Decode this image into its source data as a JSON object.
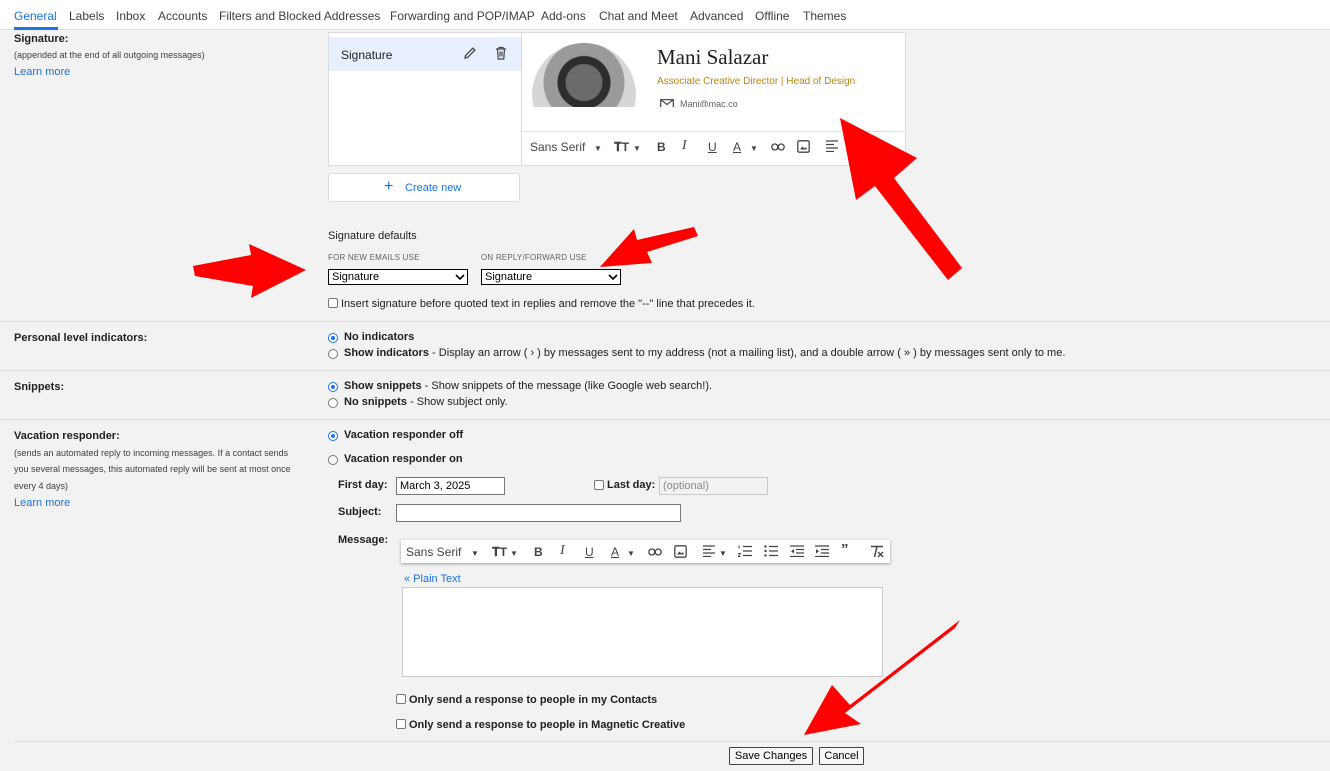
{
  "tabs": [
    "General",
    "Labels",
    "Inbox",
    "Accounts",
    "Filters and Blocked Addresses",
    "Forwarding and POP/IMAP",
    "Add-ons",
    "Chat and Meet",
    "Advanced",
    "Offline",
    "Themes"
  ],
  "signature": {
    "title": "Signature:",
    "desc": "(appended at the end of all outgoing messages)",
    "learn_more": "Learn more",
    "item_label": "Signature",
    "preview": {
      "name": "Mani Salazar",
      "role": "Associate Creative Director | Head of Design",
      "email": "Mani@mac.co"
    },
    "toolbar": {
      "font": "Sans Serif"
    },
    "create_new": "Create new",
    "defaults_title": "Signature defaults",
    "new_label": "FOR NEW EMAILS USE",
    "new_value": "Signature",
    "reply_label": "ON REPLY/FORWARD USE",
    "reply_value": "Signature",
    "insert_before": "Insert signature before quoted text in replies and remove the \"--\" line that precedes it."
  },
  "personal": {
    "title": "Personal level indicators:",
    "opt1": "No indicators",
    "opt2": "Show indicators",
    "opt2_desc": " - Display an arrow ( › ) by messages sent to my address (not a mailing list), and a double arrow ( » ) by messages sent only to me."
  },
  "snippets": {
    "title": "Snippets:",
    "opt1": "Show snippets",
    "opt1_desc": " - Show snippets of the message (like Google web search!).",
    "opt2": "No snippets",
    "opt2_desc": " - Show subject only."
  },
  "vacation": {
    "title": "Vacation responder:",
    "desc1": "(sends an automated reply to incoming messages. If a contact sends",
    "desc2": "you several messages, this automated reply will be sent at most once",
    "desc3": "every 4 days)",
    "learn_more": "Learn more",
    "off": "Vacation responder off",
    "on": "Vacation responder on",
    "first_day_label": "First day:",
    "first_day_value": "March 3, 2025",
    "last_day_label": "Last day:",
    "last_day_placeholder": "(optional)",
    "subject_label": "Subject:",
    "message_label": "Message:",
    "toolbar_font": "Sans Serif",
    "plain_text": "« Plain Text",
    "only_contacts": "Only send a response to people in my Contacts",
    "only_org": "Only send a response to people in Magnetic Creative"
  },
  "buttons": {
    "save": "Save Changes",
    "cancel": "Cancel"
  },
  "colors": {
    "accent": "#1a73e8",
    "arrow": "#ff0000"
  }
}
